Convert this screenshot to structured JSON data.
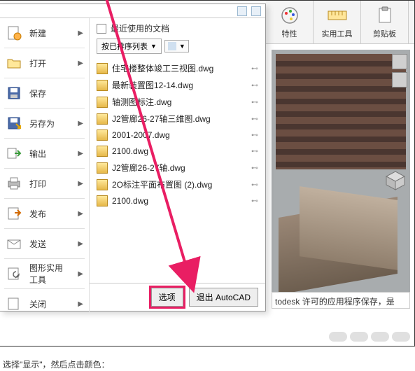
{
  "ribbon": {
    "props": "特性",
    "tools": "实用工具",
    "clipboard": "剪贴板"
  },
  "menu": {
    "new": "新建",
    "open": "打开",
    "save": "保存",
    "saveas": "另存为",
    "export": "输出",
    "print": "打印",
    "publish": "发布",
    "send": "发送",
    "util": "图形实用工具",
    "close": "关闭"
  },
  "recent": {
    "title": "最近使用的文档",
    "sort": "按已排序列表",
    "files": [
      "住宅楼整体竣工三视图.dwg",
      "最新装置图12-14.dwg",
      "轴测图标注.dwg",
      "J2管廊26-27轴三维图.dwg",
      "2001-2007.dwg",
      "2100.dwg",
      "J2管廊26-27轴.dwg",
      "2O标注平面布置图 (2).dwg",
      "2100.dwg"
    ]
  },
  "bottom": {
    "options": "选项",
    "exit": "退出 AutoCAD"
  },
  "status": "todesk 许可的应用程序保存，是",
  "caption": "选择\"显示\"，然后点击颜色："
}
